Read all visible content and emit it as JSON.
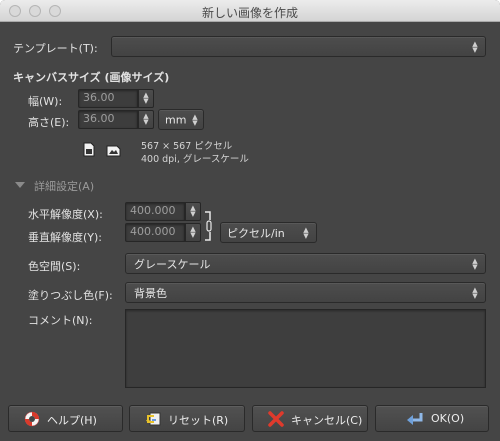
{
  "window": {
    "title": "新しい画像を作成"
  },
  "template": {
    "label": "テンプレート(T):",
    "value": ""
  },
  "canvas_size": {
    "heading": "キャンバスサイズ (画像サイズ)",
    "width_label": "幅(W):",
    "width_value": "36.00",
    "height_label": "高さ(E):",
    "height_value": "36.00",
    "unit": "mm",
    "pixel_info": "567 × 567 ピクセル",
    "dpi_info": "400 dpi, グレースケール"
  },
  "advanced": {
    "heading": "詳細設定(A)",
    "xres_label": "水平解像度(X):",
    "xres_value": "400.000",
    "yres_label": "垂直解像度(Y):",
    "yres_value": "400.000",
    "res_unit": "ピクセル/in",
    "colorspace_label": "色空間(S):",
    "colorspace_value": "グレースケール",
    "fill_label": "塗りつぶし色(F):",
    "fill_value": "背景色",
    "comment_label": "コメント(N):",
    "comment_value": ""
  },
  "buttons": {
    "help": "ヘルプ(H)",
    "reset": "リセット(R)",
    "cancel": "キャンセル(C)",
    "ok": "OK(O)"
  },
  "icons": {
    "portrait": "portrait-icon",
    "landscape": "landscape-icon",
    "chain": "chain-icon",
    "help": "lifebuoy-icon",
    "reset": "reset-icon",
    "cancel": "cancel-x-icon",
    "ok": "enter-arrow-icon"
  }
}
